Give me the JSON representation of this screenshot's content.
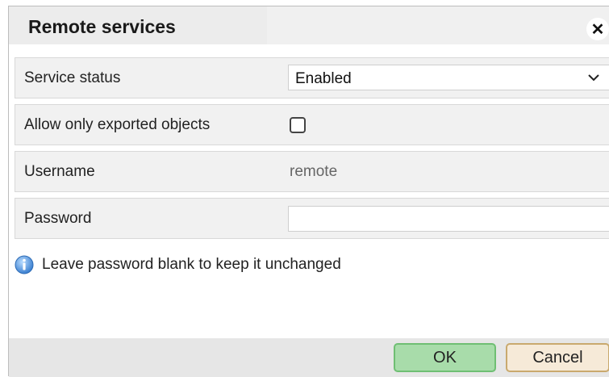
{
  "dialog": {
    "title": "Remote services",
    "close_icon": "close-icon"
  },
  "form": {
    "service_status": {
      "label": "Service status",
      "value": "Enabled"
    },
    "allow_exported": {
      "label": "Allow only exported objects",
      "checked": false
    },
    "username": {
      "label": "Username",
      "value": "remote"
    },
    "password": {
      "label": "Password",
      "value": ""
    }
  },
  "info": {
    "icon": "info-icon",
    "text": "Leave password blank to keep it unchanged"
  },
  "buttons": {
    "ok": "OK",
    "cancel": "Cancel"
  },
  "colors": {
    "ok_bg": "#a8dcaa",
    "ok_border": "#6fbf73",
    "cancel_bg": "#f6ead8",
    "cancel_border": "#c9a96e",
    "info_icon": "#4a8fd6"
  }
}
